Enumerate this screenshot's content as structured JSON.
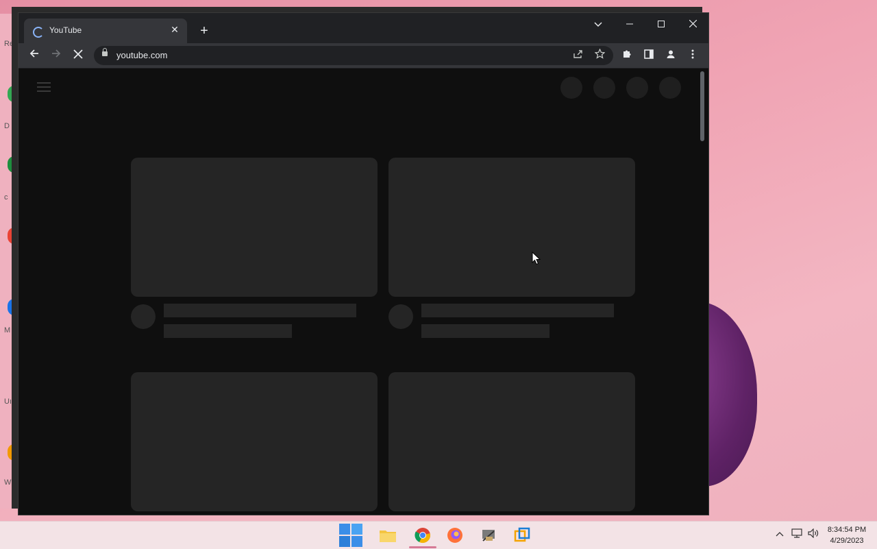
{
  "browser": {
    "tab": {
      "title": "YouTube"
    },
    "address": {
      "url": "youtube.com"
    }
  },
  "taskbar": {
    "apps": [
      "start-icon",
      "file-explorer-icon",
      "chrome-icon",
      "firefox-icon",
      "app-icon",
      "virtualbox-icon"
    ],
    "clock": {
      "time": "8:34:54 PM",
      "date": "4/29/2023"
    }
  },
  "desktop_fragments": [
    "Re",
    "D",
    "c",
    "Uı",
    "W",
    "M"
  ],
  "colors": {
    "desktop_bg": "#f0a4b4",
    "browser_bg": "#0f0f0f",
    "placeholder": "#252525",
    "accent": "#8ab4f8"
  }
}
